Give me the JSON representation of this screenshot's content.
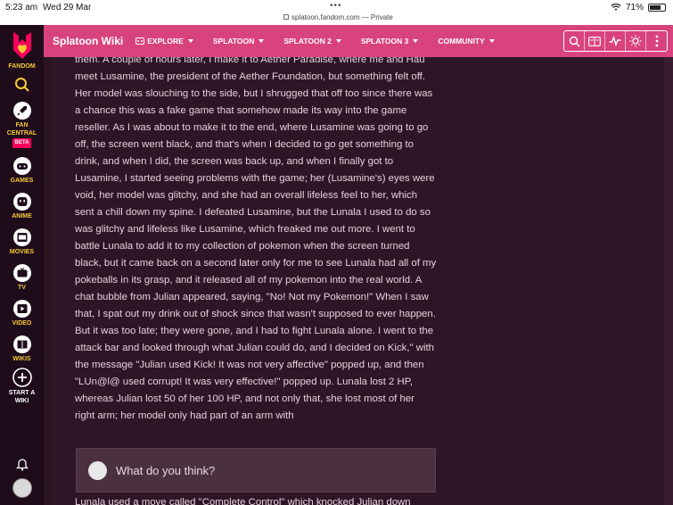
{
  "status_bar": {
    "time": "5:23 am",
    "date": "Wed 29 Mar",
    "url": "splatoon.fandom.com — Private",
    "battery": "71%"
  },
  "rail": {
    "brand": "FANDOM",
    "items": [
      {
        "label": "FAN CENTRAL",
        "badge": "BETA",
        "icon": "rocket-icon"
      },
      {
        "label": "GAMES",
        "icon": "gamepad-icon"
      },
      {
        "label": "ANIME",
        "icon": "anime-icon"
      },
      {
        "label": "MOVIES",
        "icon": "film-icon"
      },
      {
        "label": "TV",
        "icon": "tv-icon"
      },
      {
        "label": "VIDEO",
        "icon": "play-icon"
      },
      {
        "label": "WIKIS",
        "icon": "book-icon"
      },
      {
        "label": "START A WIKI",
        "icon": "plus-icon"
      }
    ]
  },
  "wikibar": {
    "title": "Splatoon Wiki",
    "nav": [
      "EXPLORE",
      "SPLATOON",
      "SPLATOON 2",
      "SPLATOON 3",
      "COMMUNITY"
    ]
  },
  "article": {
    "text": "them. A couple of hours later, I make it to Aether Paradise, where me and Hau meet Lusamine, the president of the Aether Foundation, but something felt off. Her model was slouching to the side, but I shrugged that off too since there was a chance this was a fake game that somehow made its way into the game reseller. As I was about to make it to the end, where Lusamine was going to go off, the screen went black, and that's when I decided to go get something to drink, and when I did, the screen was back up, and when I finally got to Lusamine, I started seeing problems with the game; her (Lusamine's) eyes were void, her model was glitchy, and she had an overall lifeless feel to her, which sent a chill down my spine. I defeated Lusamine, but the Lunala I used to do so was glitchy and lifeless like Lusamine, which freaked me out more. I went to battle Lunala to add it to my collection of pokemon when the screen turned black, but it came back on a second later only for me to see Lunala had all of my pokeballs in its grasp, and it released all of my pokemon into the real world. A chat bubble from Julian appeared, saying, \"No! Not my Pokemon!\" When I saw that, I spat out my drink out of shock since that wasn't supposed to ever happen. But it was too late; they were gone, and I had to fight Lunala alone. I went to the attack bar and looked through what Julian could do, and I decided on Kick,\" with the message \"Julian used Kick! It was not very affective\" popped up, and then \"LUn@l@ used corrupt! It was very effective!\" popped up. Lunala lost 2 HP, whereas Julian lost 50 of her 100 HP, and not only that, she lost most of her right arm; her model only had part of an arm with",
    "comment_prompt": "What do you think?",
    "after_text": "Lunala used a move called \"Complete Control\" which knocked Julian down"
  }
}
